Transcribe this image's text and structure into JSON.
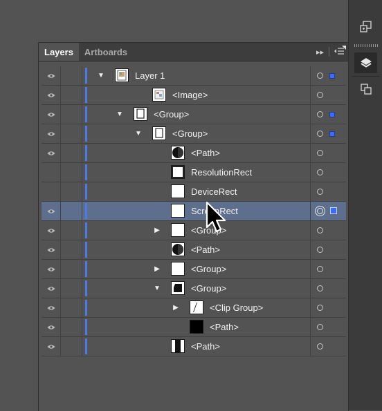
{
  "tabs": [
    {
      "label": "Layers",
      "active": true
    },
    {
      "label": "Artboards",
      "active": false
    }
  ],
  "panel_menu": {
    "expand_icon": "double-chevron-right-icon",
    "menu_icon": "panel-menu-icon"
  },
  "dock": {
    "items": [
      {
        "icon": "artboard-navigation-icon"
      },
      {
        "icon": "layers-icon",
        "active": true
      },
      {
        "icon": "artboards-icon"
      }
    ]
  },
  "colors": {
    "layer_color": "#4b7be8",
    "selection_row": "#5d6f8c",
    "selection_square": "#3c6cff"
  },
  "layers": [
    {
      "name": "Layer 1",
      "depth": 0,
      "expander": "open",
      "thumb": "layer",
      "visible": true,
      "selected_marker": true,
      "selected": false
    },
    {
      "name": "<Image>",
      "depth": 2,
      "expander": "none",
      "thumb": "image",
      "visible": true,
      "selected_marker": false,
      "selected": false
    },
    {
      "name": "<Group>",
      "depth": 1,
      "expander": "open",
      "thumb": "group-outline",
      "visible": true,
      "selected_marker": true,
      "selected": false
    },
    {
      "name": "<Group>",
      "depth": 2,
      "expander": "open",
      "thumb": "group-outline",
      "visible": true,
      "selected_marker": true,
      "selected": false
    },
    {
      "name": "<Path>",
      "depth": 3,
      "expander": "none",
      "thumb": "circle-dark",
      "visible": true,
      "selected_marker": false,
      "selected": false
    },
    {
      "name": "ResolutionRect",
      "depth": 3,
      "expander": "none",
      "thumb": "rect-bordered",
      "visible": false,
      "selected_marker": false,
      "selected": false
    },
    {
      "name": "DeviceRect",
      "depth": 3,
      "expander": "none",
      "thumb": "white",
      "visible": false,
      "selected_marker": false,
      "selected": false
    },
    {
      "name": "ScreenRect",
      "depth": 3,
      "expander": "none",
      "thumb": "white",
      "visible": true,
      "selected_marker": true,
      "selected": true
    },
    {
      "name": "<Group>",
      "depth": 3,
      "expander": "closed",
      "thumb": "white",
      "visible": true,
      "selected_marker": false,
      "selected": false
    },
    {
      "name": "<Path>",
      "depth": 3,
      "expander": "none",
      "thumb": "circle-dark",
      "visible": true,
      "selected_marker": false,
      "selected": false
    },
    {
      "name": "<Group>",
      "depth": 3,
      "expander": "closed",
      "thumb": "white",
      "visible": true,
      "selected_marker": false,
      "selected": false
    },
    {
      "name": "<Group>",
      "depth": 3,
      "expander": "open",
      "thumb": "shape-dark",
      "visible": true,
      "selected_marker": false,
      "selected": false
    },
    {
      "name": "<Clip Group>",
      "depth": 4,
      "expander": "closed",
      "thumb": "clip",
      "visible": true,
      "selected_marker": false,
      "selected": false
    },
    {
      "name": "<Path>",
      "depth": 4,
      "expander": "none",
      "thumb": "black",
      "visible": true,
      "selected_marker": false,
      "selected": false
    },
    {
      "name": "<Path>",
      "depth": 3,
      "expander": "none",
      "thumb": "bar-dark",
      "visible": true,
      "selected_marker": false,
      "selected": false
    }
  ]
}
